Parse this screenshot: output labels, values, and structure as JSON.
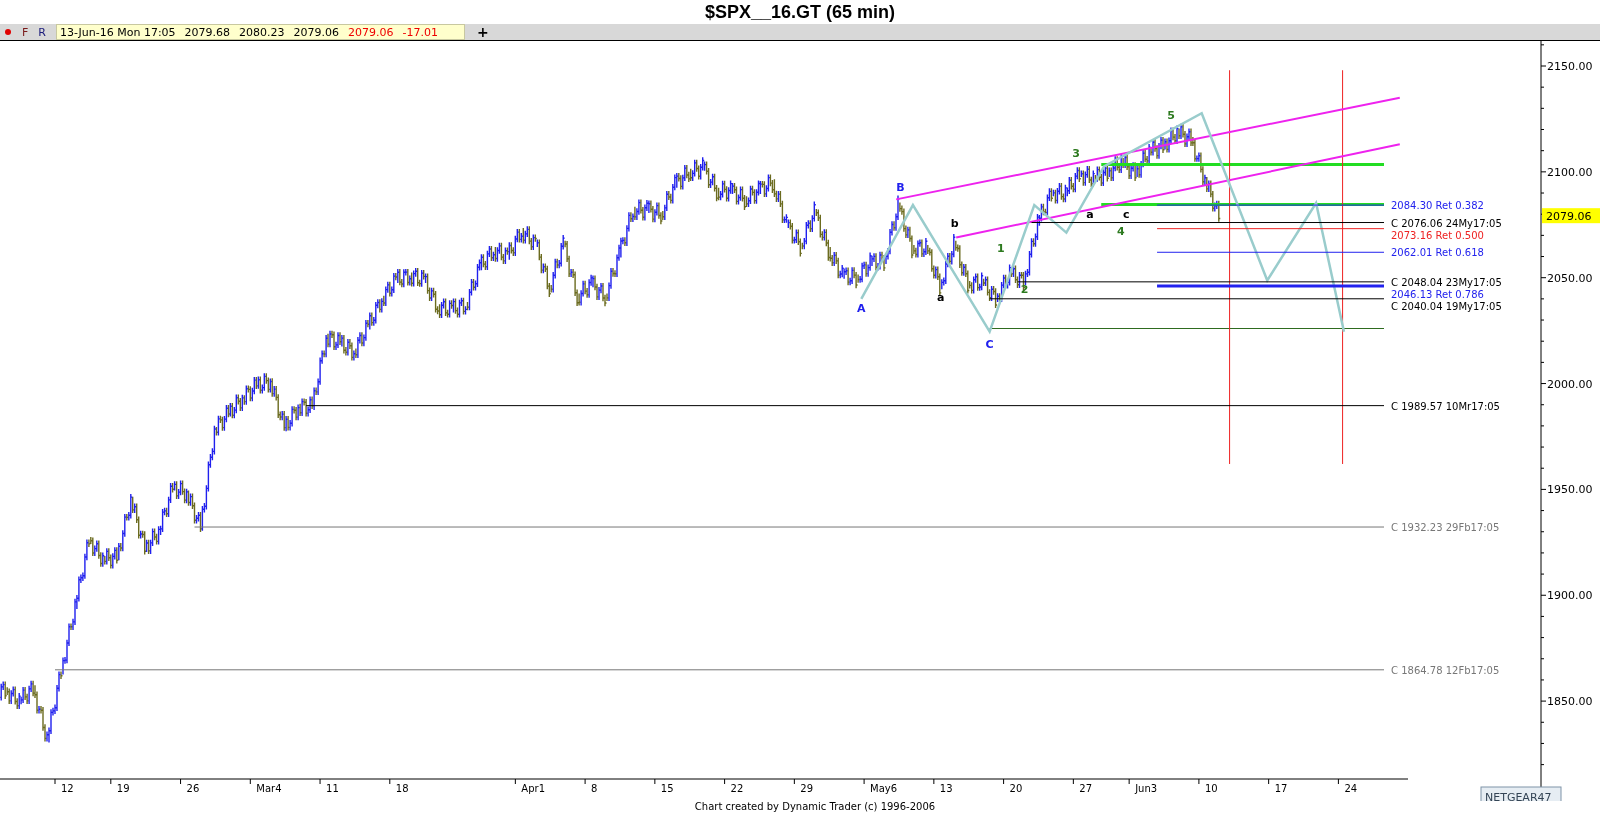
{
  "window": {
    "title": "$SPX__16.GT (65 min)"
  },
  "toolbar": {
    "buttons": [
      {
        "label": "F",
        "kind": "file"
      },
      {
        "label": "R",
        "kind": "refresh"
      }
    ],
    "quote": [
      {
        "text": "13-Jun-16 Mon 17:05",
        "kind": "plain"
      },
      {
        "text": "2079.68",
        "kind": "plain"
      },
      {
        "text": "2080.23",
        "kind": "plain"
      },
      {
        "text": "2079.06",
        "kind": "plain"
      },
      {
        "text": "2079.06",
        "kind": "change"
      },
      {
        "text": "-17.01",
        "kind": "change"
      }
    ],
    "add_button": "+"
  },
  "chart": {
    "y_axis_labels": [
      "2150.00",
      "2100.00",
      "2050.00",
      "2000.00",
      "1950.00",
      "1900.00",
      "1850.00"
    ],
    "x_axis_labels": [
      "12",
      "19",
      "26",
      "Mar4",
      "11",
      "18",
      "Apr1",
      "8",
      "15",
      "22",
      "29",
      "May6",
      "13",
      "20",
      "27",
      "Jun3",
      "10",
      "17",
      "24"
    ],
    "level_labels": [
      {
        "text": "2084.30 Ret 0.382",
        "color": "#2222ee"
      },
      {
        "text": "C 2076.06 24My17:05",
        "color": "#000000"
      },
      {
        "text": "2073.16 Ret 0.500",
        "color": "#ee2222"
      },
      {
        "text": "2062.01 Ret 0.618",
        "color": "#2222ee"
      },
      {
        "text": "C 2048.04 23My17:05",
        "color": "#000000"
      },
      {
        "text": "2046.13 Ret 0.786",
        "color": "#2222ee"
      },
      {
        "text": "C 2040.04 19My17:05",
        "color": "#000000"
      },
      {
        "text": "C 1989.57 10Mr17:05",
        "color": "#000000"
      },
      {
        "text": "C 1932.23 29Fb17:05",
        "color": "#777777"
      },
      {
        "text": "C 1864.78 12Fb17:05",
        "color": "#777777"
      }
    ],
    "last_price": "2079.06",
    "wave_labels": [
      {
        "text": "A",
        "color": "#2020ee"
      },
      {
        "text": "B",
        "color": "#2020ee"
      },
      {
        "text": "a",
        "color": "#000000"
      },
      {
        "text": "b",
        "color": "#000000"
      },
      {
        "text": "C",
        "color": "#2020ee"
      },
      {
        "text": "1",
        "color": "#2d7a1f"
      },
      {
        "text": "2",
        "color": "#2d7a1f"
      },
      {
        "text": "3",
        "color": "#2d7a1f"
      },
      {
        "text": "a",
        "color": "#000000"
      },
      {
        "text": "c",
        "color": "#000000"
      },
      {
        "text": "4",
        "color": "#2d7a1f"
      },
      {
        "text": "5",
        "color": "#2d7a1f"
      }
    ],
    "badge": "NETGEAR47"
  },
  "footer": "Chart created by Dynamic Trader  (c) 1996-2006"
}
